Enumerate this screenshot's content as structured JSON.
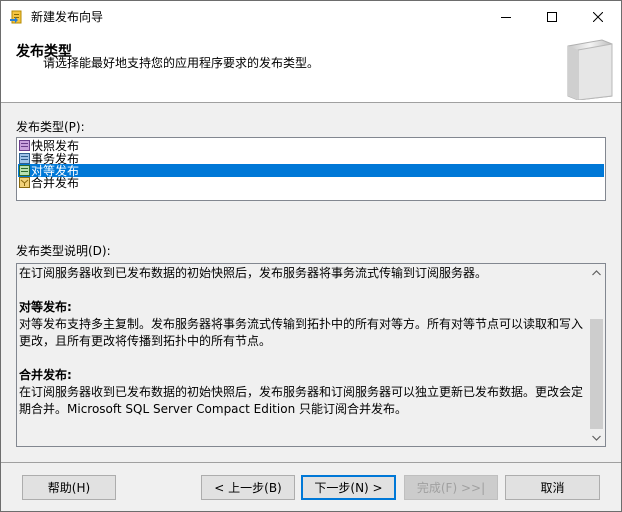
{
  "window": {
    "title": "新建发布向导",
    "controls": [
      "minimize",
      "maximize",
      "close"
    ]
  },
  "header": {
    "title": "发布类型",
    "description": "请选择能最好地支持您的应用程序要求的发布类型。"
  },
  "publication_types": {
    "label": "发布类型(P):",
    "items": [
      {
        "label": "快照发布",
        "icon": "snapshot-publication-icon",
        "selected": false
      },
      {
        "label": "事务发布",
        "icon": "transactional-publication-icon",
        "selected": false
      },
      {
        "label": "对等发布",
        "icon": "peer-to-peer-publication-icon",
        "selected": true
      },
      {
        "label": "合并发布",
        "icon": "merge-publication-icon",
        "selected": false
      }
    ]
  },
  "description": {
    "label": "发布类型说明(D):",
    "paragraphs": [
      {
        "text": "在订阅服务器收到已发布数据的初始快照后，发布服务器将事务流式传输到订阅服务器。"
      },
      {
        "heading": "对等发布:",
        "text": "对等发布支持多主复制。发布服务器将事务流式传输到拓扑中的所有对等方。所有对等节点可以读取和写入更改，且所有更改将传播到拓扑中的所有节点。"
      },
      {
        "heading": "合并发布:",
        "text": "在订阅服务器收到已发布数据的初始快照后，发布服务器和订阅服务器可以独立更新已发布数据。更改会定期合并。Microsoft SQL Server Compact Edition 只能订阅合并发布。"
      }
    ]
  },
  "buttons": {
    "help": "帮助(H)",
    "back": "< 上一步(B)",
    "next": "下一步(N) >",
    "finish": "完成(F) >>|",
    "cancel": "取消"
  }
}
